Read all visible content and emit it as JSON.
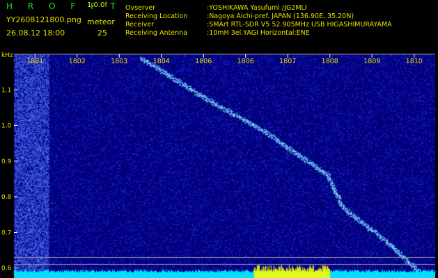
{
  "header": {
    "brand": "H R O F F T",
    "version": "1.0.0f",
    "filename": "YY2608121800.png",
    "meteor_label": "meteor",
    "meteor_count": "25",
    "timestamp": "26.08.12 18:00",
    "info": [
      {
        "key": "Ovserver",
        "value": ":YOSHIKAWA Yasufumi /JG2MLI"
      },
      {
        "key": "Receiving Location",
        "value": ":Nagoya Aichi-pref. JAPAN (136.90E, 35.20N)"
      },
      {
        "key": "Receiver",
        "value": ":SMArt RTL-SDR V5 52.905MHz USB HIGASHIMURAYAMA"
      },
      {
        "key": "Receiving Antenna",
        "value": ":10mH 3el.YAGI Horizontal:ENE"
      }
    ]
  },
  "chart_data": {
    "type": "heatmap",
    "ylabel": "kHz",
    "x_tick_labels": [
      "1801",
      "1802",
      "1803",
      "1804",
      "1806",
      "1806",
      "1807",
      "1808",
      "1809",
      "1810"
    ],
    "y_ticks": [
      0.6,
      0.7,
      0.8,
      0.9,
      1.0,
      1.1
    ],
    "y_tick_labels": [
      "0.6",
      "0.7",
      "0.8",
      "0.9",
      "1.0",
      "1.1"
    ],
    "ylim": [
      0.58,
      1.2
    ],
    "xlim": [
      1800.5,
      1810.5
    ],
    "trace": [
      [
        1803.5,
        1.19
      ],
      [
        1805.0,
        1.08
      ],
      [
        1806.5,
        0.98
      ],
      [
        1807.6,
        0.89
      ],
      [
        1807.95,
        0.86
      ],
      [
        1808.3,
        0.77
      ],
      [
        1809.3,
        0.68
      ],
      [
        1810.1,
        0.59
      ]
    ],
    "colors": {
      "noise_low": "#00007a",
      "noise_high": "#3a3aff",
      "trace": "#5fd0ff",
      "axis_text": "#e8e000",
      "floor": "#00e0ff",
      "burst": "#ffff00",
      "frame": "#8f8fa8"
    }
  }
}
